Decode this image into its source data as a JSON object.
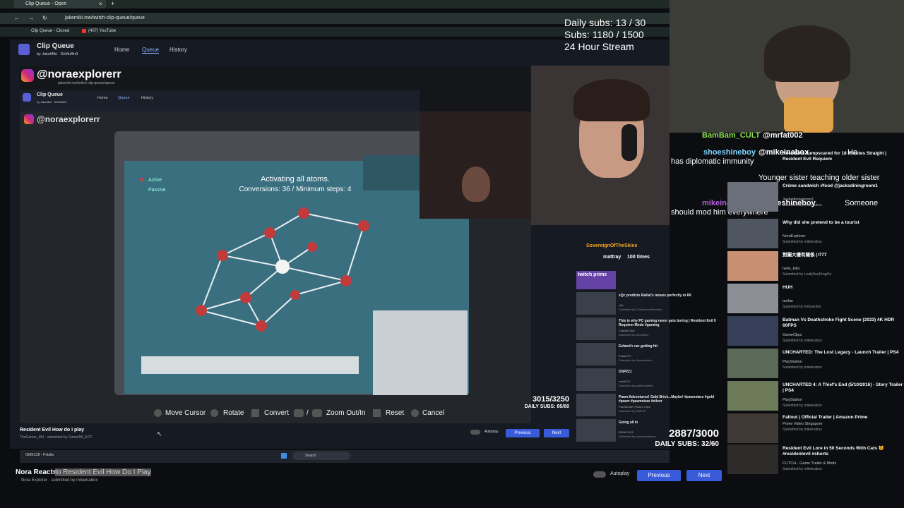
{
  "browser": {
    "tab_label": "Clip Queue - Open",
    "url": "jakemiki.me/twitch-clip-queue/queue",
    "bookmark_1": "Clip Queue - Closed",
    "bookmark_2": "(407) YouTube"
  },
  "site": {
    "title": "Clip Queue",
    "byline": "by JakeMiki · SirMuffin9",
    "nav": [
      "Home",
      "Queue",
      "History"
    ]
  },
  "stats": {
    "daily_subs": "Daily subs: 13 / 30",
    "subs": "Subs: 1180 / 1500",
    "stream": "24 Hour Stream"
  },
  "watermark_outer": "@noraexplorerr",
  "watermark_inner": "@noraexplorerr",
  "inner_url": "jakemiki.me/twitch-clip-queue/queue",
  "inner_site": {
    "title": "Clip Queue",
    "byline": "by JakeMiki · SirMuffin9",
    "nav": [
      "Home",
      "Queue",
      "History"
    ]
  },
  "game_screen": {
    "line1": "Activating all atoms.",
    "line2": "Conversions: 36 / Minimum steps: 4",
    "legend_active": "Active",
    "legend_passive": "Passive"
  },
  "controls": {
    "move": "Move Cursor",
    "rotate": "Rotate",
    "convert": "Convert",
    "zoom": "Zoom Out/In",
    "reset": "Reset",
    "cancel": "Cancel",
    "zoom_sep": "/"
  },
  "inner_counters": {
    "count": "3015/3250",
    "daily": "DAILY SUBS: 85/60"
  },
  "outer_counters": {
    "count": "2887/3000",
    "daily": "DAILY SUBS: 32/60"
  },
  "clip_info": {
    "title": "Resident Evil How do i play",
    "sub": "TheGamer_MU · submitted by GamerMI_EOT",
    "autoplay": "Autoplay",
    "prev": "Previous",
    "next": "Next"
  },
  "bottom_info": {
    "title_a": "Nora Reacts",
    "title_b": " to Resident Evil How Do I Play",
    "sub": "Nora Explorer · submitted by mikeinabox",
    "autoplay": "Autoplay",
    "prev": "Previous",
    "next": "Next"
  },
  "taskbar": {
    "search": "Search",
    "weather": "GMSC28 - Pelalto"
  },
  "chat": [
    {
      "user": "BamBam_CULT",
      "mention": "@mrfat002",
      "text": "",
      "color": "#8be04e"
    },
    {
      "user": "shoeshineboy",
      "mention": "@mikeinabox",
      "text": "He has diplomatic immunity",
      "color": "#ffffff"
    },
    {
      "user": "",
      "mention": "",
      "text": "Younger sister teaching older sister",
      "color": "#ffffff"
    },
    {
      "user": "mikeinabox",
      "mention": "@shoeshineboy",
      "text": "Someone should mod him everywhere",
      "color": "#b45fd6"
    }
  ],
  "queue": [
    {
      "title": "Nora Gets Jumpscared for 18 Minutes Straight | Resident Evil Requiem",
      "channel": "",
      "submitted": "Submitted by ..."
    },
    {
      "title": "Crème sandwich #food @jacksdiningroom1",
      "channel": "Jacksdiningroom1",
      "submitted": "Submitted by mikeinabox"
    },
    {
      "title": "Why did she pretend to be a tourist",
      "channel": "NoraExplorer",
      "submitted": "Submitted by mikeinabox"
    },
    {
      "title": "對圖大樓有關係 (!777",
      "channel": "hello_kiko",
      "submitted": "Submitted by LeafySeaDragOn"
    },
    {
      "title": "HUH",
      "channel": "tzefan",
      "submitted": "Submitted by fomovictim"
    },
    {
      "title": "Batman Vs Deathstroke Fight Scene (2023) 4K HDR 60FPS",
      "channel": "GameClips",
      "submitted": "Submitted by mikeinabox"
    },
    {
      "title": "UNCHARTED: The Lost Legacy - Launch Trailer | PS4",
      "channel": "PlayStation",
      "submitted": "Submitted by mikeinabox"
    },
    {
      "title": "UNCHARTED 4: A Thief's End (5/10/2016) - Story Trailer | PS4",
      "channel": "PlayStation",
      "submitted": "Submitted by mikeinabox"
    },
    {
      "title": "Fallout | Official Trailer | Amazon Prime",
      "channel": "Prime Video Singapore",
      "submitted": "Submitted by mikeinabox"
    },
    {
      "title": "Resident Evil Lore in 50 Seconds With Cats 😺 #residentevil #shorts",
      "channel": "FLITCH - Game Trailer & Mods",
      "submitted": "Submitted by mikeinabox"
    }
  ],
  "mini_queue": [
    {
      "title": "xQc predicts RaKai's moves perfectly in R6",
      "channel": "xQc",
      "submitted": "Submitted by CristianoussRenaldo"
    },
    {
      "title": "This is why PC gaming never gets boring | Resident Evil 9 Requiem Mods #gaming",
      "channel": "CaptainClipz",
      "submitted": "Submitted by Shotsfires"
    },
    {
      "title": "Esfand's car getting hit",
      "channel": "EsfandTV",
      "submitted": "Submitted by AlbanianMan"
    },
    {
      "title": "DSP221",
      "channel": "mobb221",
      "submitted": "Submitted by swiftboxsteffa"
    },
    {
      "title": "Pawn Adventures! Gold Brick...Maybe! #pawnstars #gold #pawn #pawnstars #silver",
      "channel": "Pawnbroker Picture Clips",
      "submitted": "Submitted by SNEOP"
    },
    {
      "title": "Going all in",
      "channel": "BRINK1911",
      "submitted": "Submitted by boomvinnikeiya"
    }
  ],
  "mini_chat": [
    {
      "user": "SovereignOfTheSkies",
      "text": ""
    },
    {
      "user": "mattray",
      "text": "100 times"
    }
  ],
  "twitch_prime": "twitch prime",
  "colors": {
    "accent": "#3a5bd9",
    "site_bg": "#161a22",
    "nav_active": "#8fb3ff"
  }
}
